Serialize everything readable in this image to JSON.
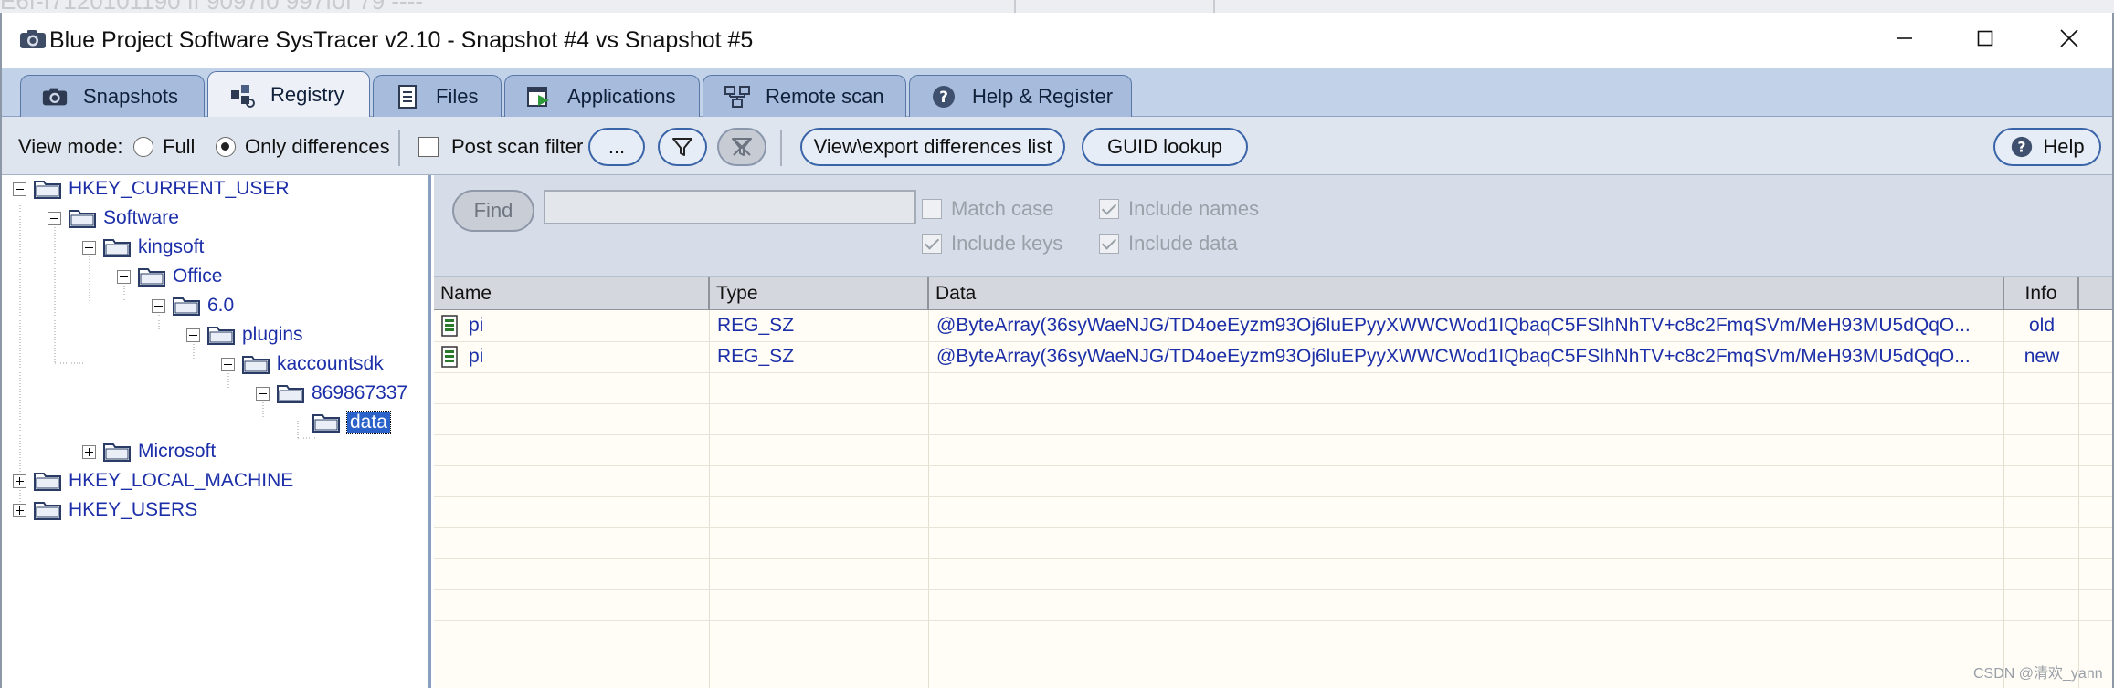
{
  "background_ghost_text": "E6f-f7120101190 ff 9097f0 997f0f 79 ----",
  "window": {
    "title": "Blue Project Software SysTracer v2.10 - Snapshot #4 vs Snapshot #5"
  },
  "tabs": [
    {
      "label": "Snapshots",
      "icon": "camera-icon",
      "active": false
    },
    {
      "label": "Registry",
      "icon": "registry-icon",
      "active": true
    },
    {
      "label": "Files",
      "icon": "files-icon",
      "active": false
    },
    {
      "label": "Applications",
      "icon": "applications-icon",
      "active": false
    },
    {
      "label": "Remote scan",
      "icon": "network-icon",
      "active": false
    },
    {
      "label": "Help & Register",
      "icon": "help-icon",
      "active": false
    }
  ],
  "toolbar": {
    "view_mode_label": "View mode:",
    "full_label": "Full",
    "only_differences_label": "Only differences",
    "selected_view_mode": "Only differences",
    "post_scan_filter_label": "Post scan filter",
    "post_scan_filter_checked": false,
    "ellipsis_label": "...",
    "view_export_label": "View\\export differences list",
    "guid_lookup_label": "GUID lookup",
    "help_label": "Help"
  },
  "tree": [
    {
      "label": "HKEY_CURRENT_USER",
      "expander": "minus"
    },
    {
      "label": "Software",
      "expander": "minus"
    },
    {
      "label": "kingsoft",
      "expander": "minus"
    },
    {
      "label": "Office",
      "expander": "minus"
    },
    {
      "label": "6.0",
      "expander": "minus"
    },
    {
      "label": "plugins",
      "expander": "minus"
    },
    {
      "label": "kaccountsdk",
      "expander": "minus"
    },
    {
      "label": "869867337",
      "expander": "minus"
    },
    {
      "label": "data",
      "expander": "none",
      "selected": true
    },
    {
      "label": "Microsoft",
      "expander": "plus"
    },
    {
      "label": "HKEY_LOCAL_MACHINE",
      "expander": "plus"
    },
    {
      "label": "HKEY_USERS",
      "expander": "plus"
    }
  ],
  "find": {
    "button_label": "Find",
    "input_value": "",
    "match_case_label": "Match case",
    "match_case_checked": false,
    "include_keys_label": "Include keys",
    "include_keys_checked": true,
    "include_names_label": "Include names",
    "include_names_checked": true,
    "include_data_label": "Include data",
    "include_data_checked": true
  },
  "grid": {
    "columns": [
      "Name",
      "Type",
      "Data",
      "Info"
    ],
    "rows": [
      {
        "name": "pi",
        "type": "REG_SZ",
        "data": "@ByteArray(36syWaeNJG/TD4oeEyzm93Oj6luEPyyXWWCWod1IQbaqC5FSlhNhTV+c8c2FmqSVm/MeH93MU5dQqO...",
        "info": "old"
      },
      {
        "name": "pi",
        "type": "REG_SZ",
        "data": "@ByteArray(36syWaeNJG/TD4oeEyzm93Oj6luEPyyXWWCWod1IQbaqC5FSlhNhTV+c8c2FmqSVm/MeH93MU5dQqO...",
        "info": "new"
      }
    ]
  },
  "watermark": "CSDN @清欢_yann",
  "colors": {
    "tab_bar": "#c2d2e8",
    "active_tab": "#edf1f7",
    "toolbar": "#dfe5ee",
    "tree_text": "#1c2fa8",
    "selection": "#2a62c9",
    "grid_background": "#fffdf5"
  }
}
